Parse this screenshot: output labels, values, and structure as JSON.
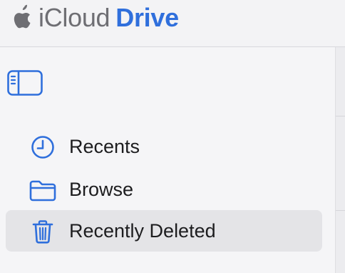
{
  "header": {
    "logo_icon": "apple-logo-icon",
    "brand_prefix": "iCloud",
    "brand_suffix": "Drive"
  },
  "sidebar": {
    "toggle_icon": "sidebar-toggle-icon",
    "items": [
      {
        "label": "Recents",
        "icon": "clock-icon",
        "selected": false
      },
      {
        "label": "Browse",
        "icon": "folder-icon",
        "selected": false
      },
      {
        "label": "Recently Deleted",
        "icon": "trash-icon",
        "selected": true
      }
    ]
  },
  "colors": {
    "accent": "#2f6fdc",
    "brand_gray": "#6e6e73",
    "selected_bg": "#e4e4e7",
    "text": "#1d1d1f"
  }
}
